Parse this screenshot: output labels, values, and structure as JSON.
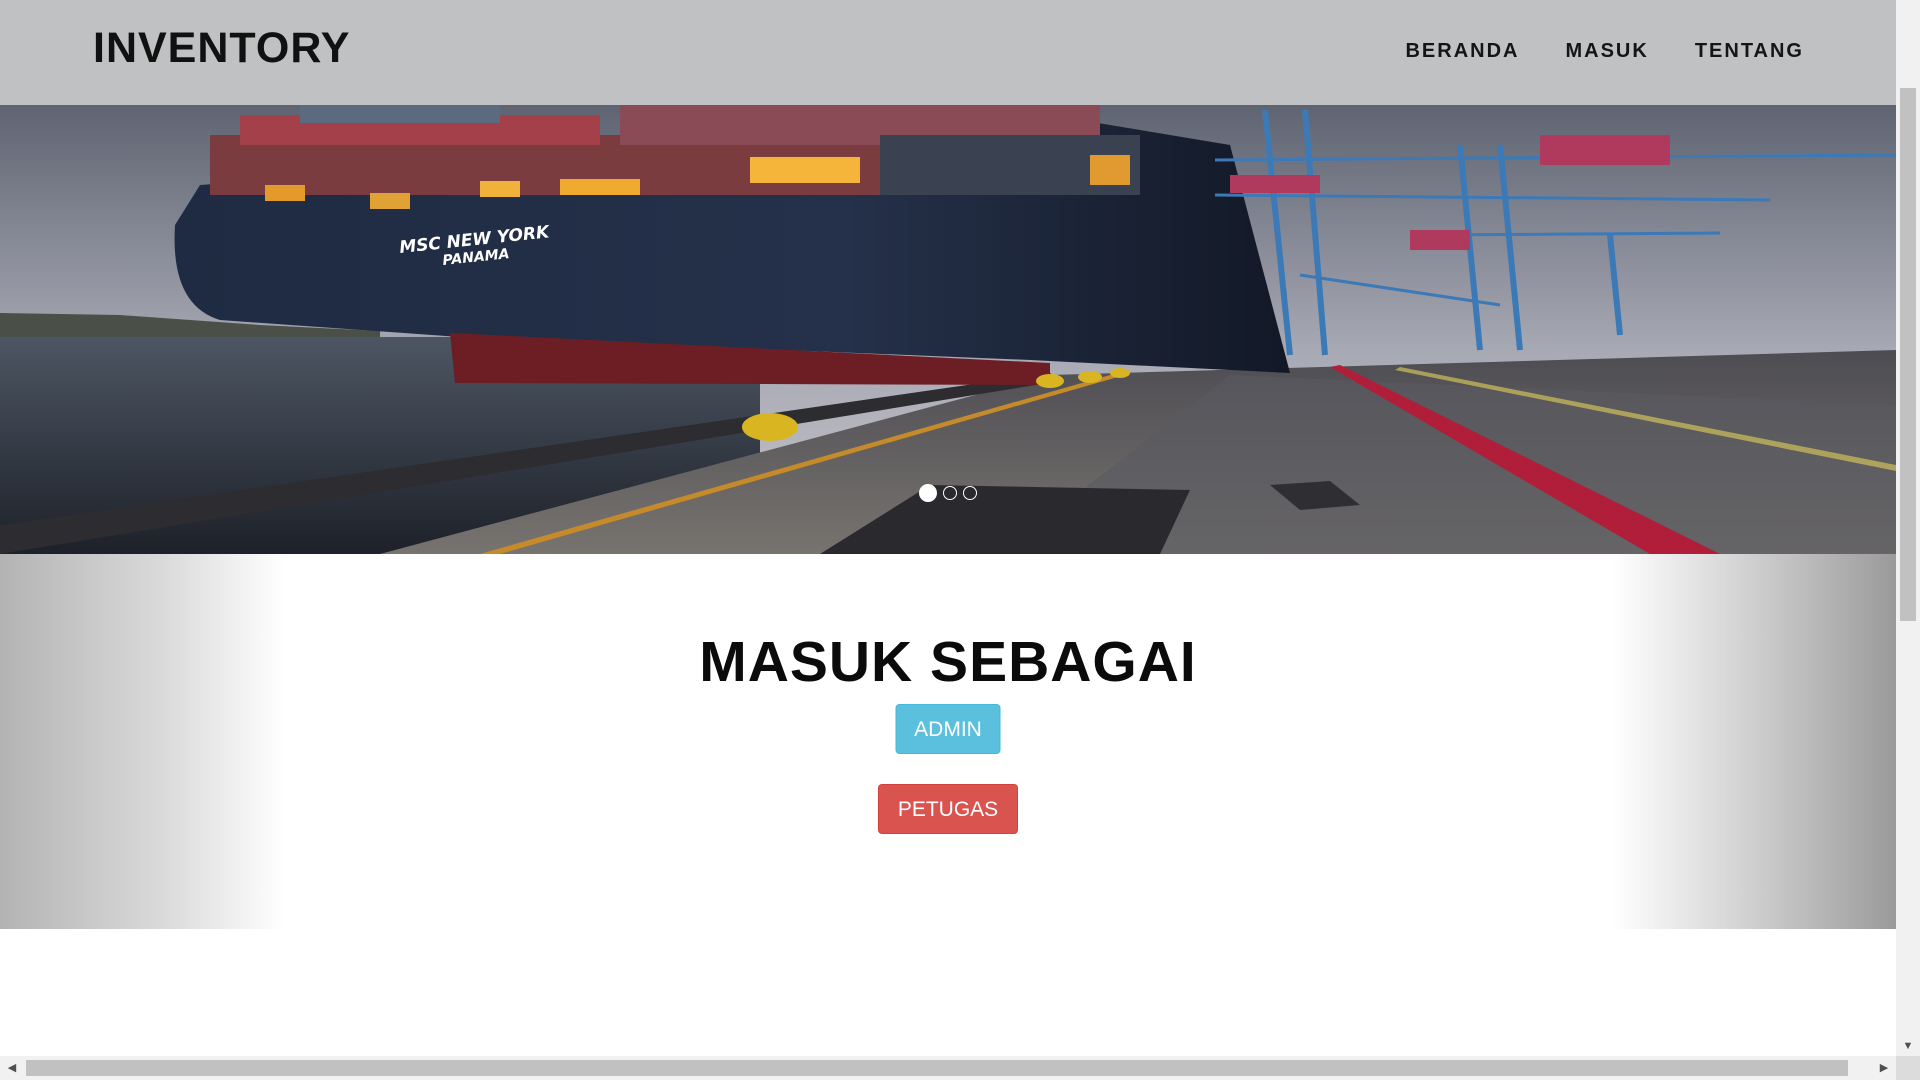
{
  "navbar": {
    "brand": "INVENTORY",
    "links": [
      "BERANDA",
      "MASUK",
      "TENTANG"
    ]
  },
  "carousel": {
    "ship_name": "MSC NEW YORK",
    "ship_port": "PANAMA",
    "slide_count": 3,
    "active_slide": 1
  },
  "login": {
    "heading": "MASUK SEBAGAI",
    "admin_label": "ADMIN",
    "petugas_label": "PETUGAS"
  },
  "colors": {
    "navbar_bg": "#bfc1c2",
    "admin_button": "#5bc0de",
    "petugas_button": "#d9534f"
  },
  "icons": {
    "scroll_down": "chevron-down-icon",
    "scroll_left": "chevron-left-icon",
    "scroll_right": "chevron-right-icon"
  }
}
